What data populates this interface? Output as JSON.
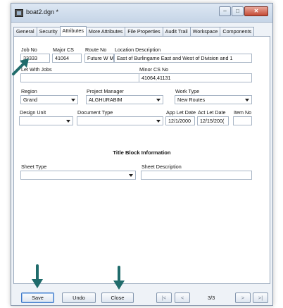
{
  "window": {
    "title": "boat2.dgn *",
    "minimize_glyph": "–",
    "restore_glyph": "□",
    "close_glyph": "✕"
  },
  "tabs": [
    "General",
    "Security",
    "Attributes",
    "More Attributes",
    "File Properties",
    "Audit Trail",
    "Workspace",
    "Components"
  ],
  "active_tab": "Attributes",
  "form": {
    "job_no": {
      "label": "Job No",
      "value": "33333"
    },
    "major_cs": {
      "label": "Major CS",
      "value": "41064"
    },
    "route_no": {
      "label": "Route No",
      "value": "Future W M"
    },
    "location_description": {
      "label": "Location Description",
      "value": "East of Burlingame East and West of Division and 1"
    },
    "let_with_jobs": {
      "label": "Let With Jobs",
      "value": ""
    },
    "minor_cs_no": {
      "label": "Minor CS No",
      "value": "41064,41131"
    },
    "region": {
      "label": "Region",
      "value": "Grand"
    },
    "project_manager": {
      "label": "Project Manager",
      "value": "ALGHURABIM"
    },
    "work_type": {
      "label": "Work Type",
      "value": "New Routes"
    },
    "design_unit": {
      "label": "Design Unit",
      "value": ""
    },
    "document_type": {
      "label": "Document Type",
      "value": ""
    },
    "app_let_date": {
      "label": "App Let Date",
      "value": "12/1/2000"
    },
    "act_let_date": {
      "label": "Act Let Date",
      "value": "12/15/200("
    },
    "item_no": {
      "label": "Item No",
      "value": ""
    },
    "title_block_heading": "Title Block Information",
    "sheet_type": {
      "label": "Sheet Type",
      "value": ""
    },
    "sheet_description": {
      "label": "Sheet Description",
      "value": ""
    }
  },
  "buttons": {
    "save": "Save",
    "undo": "Undo",
    "close": "Close",
    "first": "|<",
    "prev": "<",
    "next": ">",
    "last": ">|"
  },
  "record_counter": "3/3",
  "colors": {
    "annotation_arrow": "#1f6b6b",
    "window_background": "#eef2f7",
    "focus_border": "#3f78c8"
  }
}
